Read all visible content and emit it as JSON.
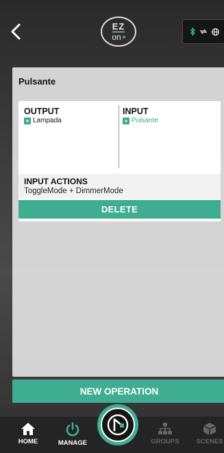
{
  "colors": {
    "accent": "#3fae90",
    "bluetooth": "#2fc29a"
  },
  "header": {
    "logo_top": "EZ",
    "logo_bottom": "on"
  },
  "panel": {
    "title": "Pulsante",
    "output": {
      "heading": "OUTPUT",
      "items": [
        "Lampada"
      ]
    },
    "input": {
      "heading": "INPUT",
      "items": [
        "Pulsante"
      ]
    },
    "actions": {
      "heading": "INPUT ACTIONS",
      "value": "ToggleMode + DimmerMode"
    },
    "delete_label": "DELETE"
  },
  "new_operation_label": "NEW OPERATION",
  "tabbar": {
    "tabs": [
      {
        "label": "HOME",
        "icon": "home-icon"
      },
      {
        "label": "MANAGE",
        "icon": "power-icon"
      },
      {
        "label": "GROUPS",
        "icon": "network-icon"
      },
      {
        "label": "SCENES",
        "icon": "box-icon"
      }
    ],
    "center_icon": "app-logo-icon"
  }
}
